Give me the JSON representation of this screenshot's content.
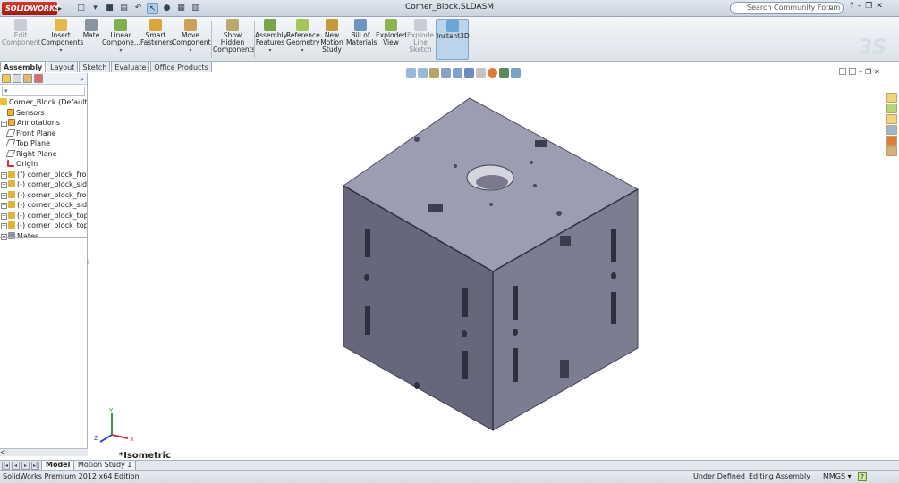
{
  "app": {
    "logo_text": "SOLIDWORKS",
    "document_title": "Corner_Block.SLDASM",
    "search_placeholder": "Search Community Forum"
  },
  "ribbon": {
    "buttons": [
      {
        "label": "Edit Component",
        "icon": "edit-component-icon",
        "disabled": true
      },
      {
        "label": "Insert Components",
        "icon": "insert-components-icon"
      },
      {
        "label": "Mate",
        "icon": "mate-icon"
      },
      {
        "label": "Linear Compone...",
        "icon": "linear-pattern-icon"
      },
      {
        "label": "Smart Fasteners",
        "icon": "smart-fasteners-icon"
      },
      {
        "label": "Move Component",
        "icon": "move-component-icon"
      },
      {
        "label": "Show Hidden Components",
        "icon": "show-hidden-icon"
      },
      {
        "label": "Assembly Features",
        "icon": "assembly-features-icon"
      },
      {
        "label": "Reference Geometry",
        "icon": "reference-geometry-icon"
      },
      {
        "label": "New Motion Study",
        "icon": "motion-study-icon"
      },
      {
        "label": "Bill of Materials",
        "icon": "bom-icon"
      },
      {
        "label": "Exploded View",
        "icon": "exploded-view-icon"
      },
      {
        "label": "Explode Line Sketch",
        "icon": "explode-line-icon",
        "disabled": true
      },
      {
        "label": "Instant3D",
        "icon": "instant3d-icon",
        "active": true
      }
    ]
  },
  "command_tabs": [
    "Assembly",
    "Layout",
    "Sketch",
    "Evaluate",
    "Office Products"
  ],
  "feature_tree": {
    "root": "Corner_Block  (Default<D",
    "items": [
      {
        "label": "Sensors",
        "icon": "sensors-icon"
      },
      {
        "label": "Annotations",
        "icon": "annotations-icon",
        "expandable": true
      },
      {
        "label": "Front Plane",
        "icon": "plane-icon"
      },
      {
        "label": "Top Plane",
        "icon": "plane-icon"
      },
      {
        "label": "Right Plane",
        "icon": "plane-icon"
      },
      {
        "label": "Origin",
        "icon": "origin-icon"
      },
      {
        "label": "(f) corner_block_front",
        "icon": "part-icon",
        "expandable": true
      },
      {
        "label": "(-) corner_block_side<",
        "icon": "part-icon",
        "expandable": true
      },
      {
        "label": "(-) corner_block_front",
        "icon": "part-icon",
        "expandable": true
      },
      {
        "label": "(-) corner_block_side<",
        "icon": "part-icon",
        "expandable": true
      },
      {
        "label": "(-) corner_block_top<",
        "icon": "part-icon",
        "expandable": true
      },
      {
        "label": "(-) corner_block_top<",
        "icon": "part-icon",
        "expandable": true
      },
      {
        "label": "Mates",
        "icon": "mates-icon",
        "expandable": true
      }
    ]
  },
  "viewport": {
    "view_orientation": "*Isometric"
  },
  "bottom_tabs": [
    "Model",
    "Motion Study 1"
  ],
  "status": {
    "edition": "SolidWorks Premium 2012 x64 Edition",
    "definition": "Under Defined",
    "mode": "Editing Assembly",
    "units": "MMGS",
    "units_arrow": "▾",
    "help": "?"
  },
  "colors": {
    "part_top": "#9a9aae",
    "part_left": "#66667a",
    "part_right": "#7b7b8f",
    "accent": "#bcd3ec"
  }
}
